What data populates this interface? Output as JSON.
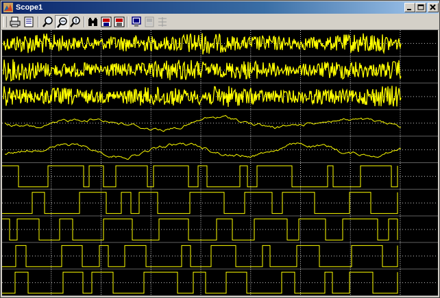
{
  "window": {
    "title": "Scope1",
    "controls": [
      "minimize",
      "maximize",
      "close"
    ]
  },
  "toolbar": {
    "buttons": [
      {
        "name": "print-button",
        "icon": "printer-icon"
      },
      {
        "name": "parameters-button",
        "icon": "parameters-icon"
      },
      {
        "name": "zoom-button",
        "icon": "magnifier-icon"
      },
      {
        "name": "zoom-x-button",
        "icon": "magnifier-x-icon",
        "pressed": true
      },
      {
        "name": "zoom-y-button",
        "icon": "magnifier-y-icon"
      },
      {
        "name": "autoscale-button",
        "icon": "binoculars-icon"
      },
      {
        "name": "save-axes-settings-button",
        "icon": "save-axes-icon"
      },
      {
        "name": "restore-axes-settings-button",
        "icon": "restore-axes-icon"
      },
      {
        "name": "floating-scope-button",
        "icon": "floating-scope-icon"
      },
      {
        "name": "lock-axes-button",
        "icon": "lock-axes-icon",
        "disabled": true
      },
      {
        "name": "signal-selection-button",
        "icon": "signal-selection-icon",
        "disabled": true
      }
    ]
  },
  "scope": {
    "background": "#000000",
    "trace_color": "#ffff00",
    "grid_color": "#ffffff",
    "axes_count": 10,
    "traces": [
      "noise",
      "noise",
      "noise",
      "random-walk",
      "random-walk",
      "pulse",
      "pulse",
      "pulse",
      "pulse",
      "pulse"
    ]
  }
}
